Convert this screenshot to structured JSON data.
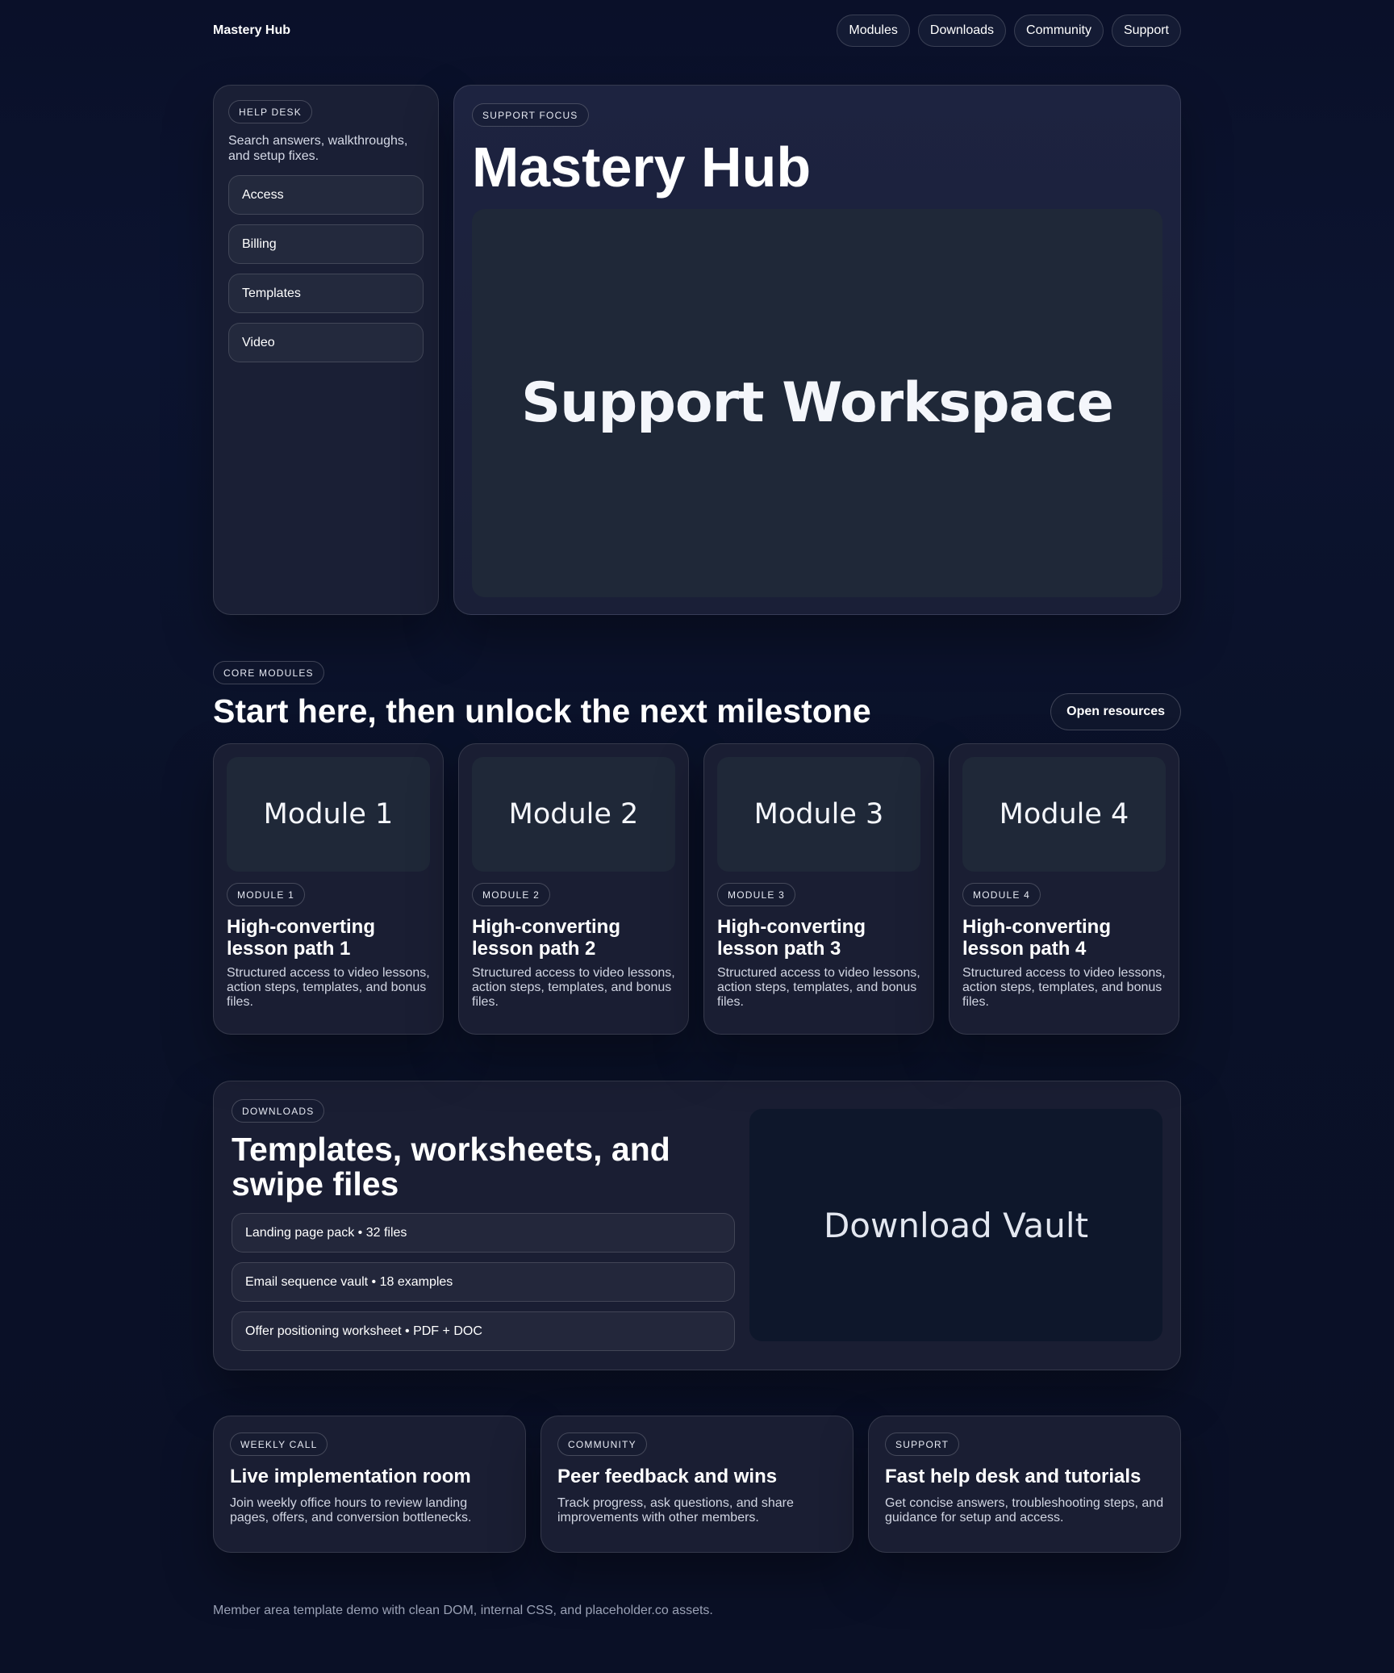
{
  "header": {
    "brand": "Mastery Hub",
    "nav": [
      "Modules",
      "Downloads",
      "Community",
      "Support"
    ]
  },
  "help_desk": {
    "tag": "HELP DESK",
    "description": "Search answers, walkthroughs, and setup fixes.",
    "items": [
      "Access",
      "Billing",
      "Templates",
      "Video"
    ]
  },
  "support_focus": {
    "tag": "SUPPORT FOCUS",
    "title": "Mastery Hub",
    "image_label": "Support Workspace"
  },
  "core_modules": {
    "tag": "CORE MODULES",
    "title": "Start here, then unlock the next milestone",
    "cta": "Open resources",
    "modules": [
      {
        "thumb": "Module 1",
        "tag": "MODULE 1",
        "title": "High-converting lesson path 1",
        "desc": "Structured access to video lessons, action steps, templates, and bonus files."
      },
      {
        "thumb": "Module 2",
        "tag": "MODULE 2",
        "title": "High-converting lesson path 2",
        "desc": "Structured access to video lessons, action steps, templates, and bonus files."
      },
      {
        "thumb": "Module 3",
        "tag": "MODULE 3",
        "title": "High-converting lesson path 3",
        "desc": "Structured access to video lessons, action steps, templates, and bonus files."
      },
      {
        "thumb": "Module 4",
        "tag": "MODULE 4",
        "title": "High-converting lesson path 4",
        "desc": "Structured access to video lessons, action steps, templates, and bonus files."
      }
    ]
  },
  "downloads": {
    "tag": "DOWNLOADS",
    "title": "Templates, worksheets, and swipe files",
    "items": [
      "Landing page pack • 32 files",
      "Email sequence vault • 18 examples",
      "Offer positioning worksheet • PDF + DOC"
    ],
    "image_label": "Download Vault"
  },
  "info_cards": [
    {
      "tag": "WEEKLY CALL",
      "title": "Live implementation room",
      "desc": "Join weekly office hours to review landing pages, offers, and conversion bottlenecks."
    },
    {
      "tag": "COMMUNITY",
      "title": "Peer feedback and wins",
      "desc": "Track progress, ask questions, and share improvements with other members."
    },
    {
      "tag": "SUPPORT",
      "title": "Fast help desk and tutorials",
      "desc": "Get concise answers, troubleshooting steps, and guidance for setup and access."
    }
  ],
  "footer": {
    "text": "Member area template demo with clean DOM, internal CSS, and placeholder.co assets."
  }
}
